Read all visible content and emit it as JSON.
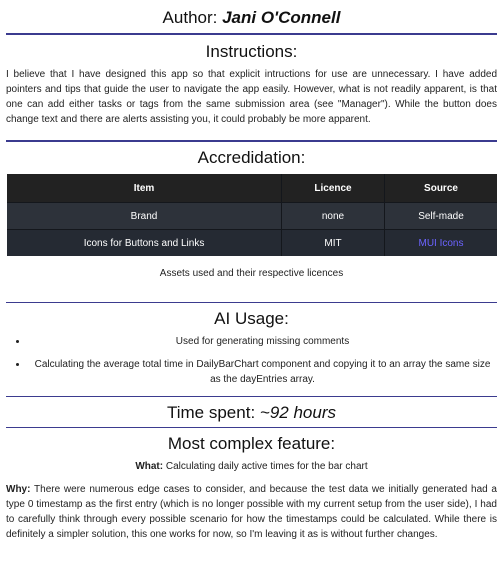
{
  "author": {
    "prefix": "Author:",
    "name": "Jani O'Connell"
  },
  "instructions": {
    "title": "Instructions:",
    "text": "I believe that I have designed this app so that explicit intructions for use are unnecessary. I have added pointers and tips that guide the user to navigate the app easily. However, what is not readily apparent, is that one can add either tasks or tags from the same submission area (see \"Manager\"). While the button does change text and there are alerts assisting you, it could probably be more apparent."
  },
  "accreditation": {
    "title": "Accredidation:",
    "headers": [
      "Item",
      "Licence",
      "Source"
    ],
    "rows": [
      {
        "item": "Brand",
        "licence": "none",
        "source": "Self-made"
      },
      {
        "item": "Icons for Buttons and Links",
        "licence": "MIT",
        "source": "MUI Icons"
      }
    ],
    "link_color": "#6b63ff",
    "caption": "Assets used and their respective licences"
  },
  "ai_usage": {
    "title": "AI Usage:",
    "items": [
      "Used for generating missing comments",
      "Calculating the average total time in DailyBarChart component and copying it to an array the same size as the dayEntries array."
    ]
  },
  "time_spent": {
    "prefix": "Time spent:",
    "value": "~92 hours"
  },
  "complex_feature": {
    "title": "Most complex feature:",
    "what_label": "What:",
    "what_text": "Calculating daily active times for the bar chart",
    "why_label": "Why:",
    "why_text": "There were numerous edge cases to consider, and because the test data we initially generated had a type 0 timestamp as the first entry (which is no longer possible with my current setup from the user side), I had to carefully think through every possible scenario for how the timestamps could be calculated. While there is definitely a simpler solution, this one works for now, so I'm leaving it as is without further changes."
  }
}
